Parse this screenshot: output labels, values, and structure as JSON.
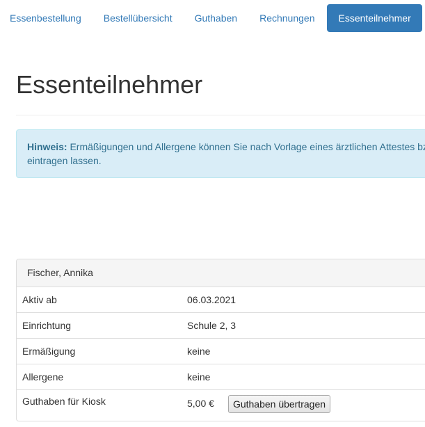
{
  "nav": {
    "items": [
      {
        "label": "Essenbestellung",
        "active": false
      },
      {
        "label": "Bestellübersicht",
        "active": false
      },
      {
        "label": "Guthaben",
        "active": false
      },
      {
        "label": "Rechnungen",
        "active": false
      },
      {
        "label": "Essenteilnehmer",
        "active": true
      }
    ],
    "active_color": "#337ab7",
    "link_color": "#337ab7"
  },
  "page": {
    "title": "Essenteilnehmer"
  },
  "notice": {
    "prefix": "Hinweis:",
    "line1": "Ermäßigungen und Allergene können Sie nach Vorlage eines ärztlichen Attestes bz",
    "line2": "eintragen lassen.",
    "background": "#d9edf7",
    "text_color": "#31708f"
  },
  "participant": {
    "name": "Fischer, Annika",
    "rows": [
      {
        "label": "Aktiv ab",
        "value": "06.03.2021"
      },
      {
        "label": "Einrichtung",
        "value": "Schule 2, 3"
      },
      {
        "label": "Ermäßigung",
        "value": "keine"
      },
      {
        "label": "Allergene",
        "value": "keine"
      },
      {
        "label": "Guthaben für Kiosk",
        "value": "5,00 €"
      }
    ],
    "transfer_button": "Guthaben übertragen"
  }
}
